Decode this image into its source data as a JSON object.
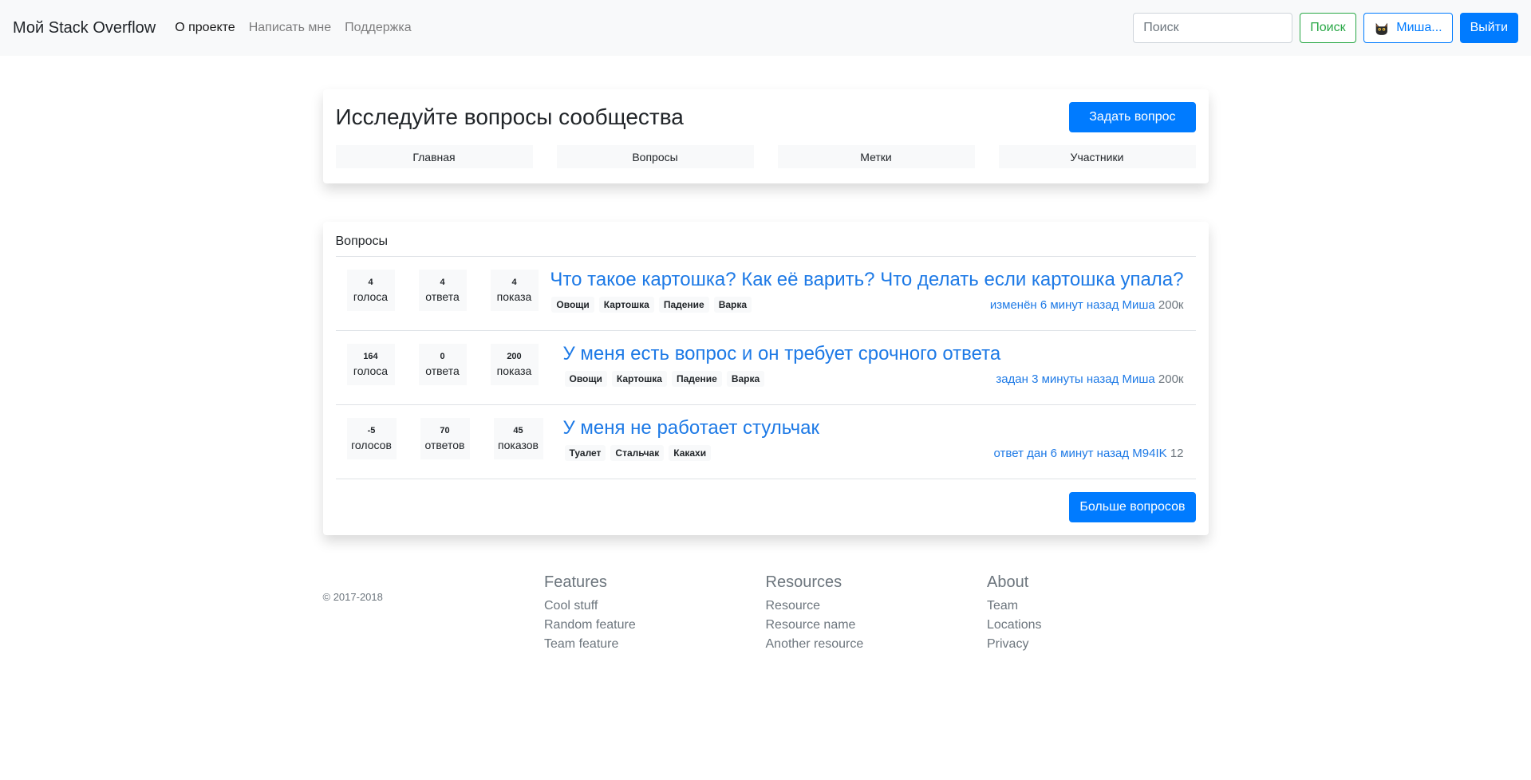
{
  "navbar": {
    "brand": "Мой Stack Overflow",
    "links": [
      "О проекте",
      "Написать мне",
      "Поддержка"
    ],
    "search_placeholder": "Поиск",
    "search_button": "Поиск",
    "user_button": "Миша...",
    "logout_button": "Выйти"
  },
  "explore": {
    "title": "Исследуйте вопросы сообщества",
    "ask_button": "Задать вопрос",
    "tabs": [
      "Главная",
      "Вопросы",
      "Метки",
      "Участники"
    ]
  },
  "questions": {
    "label": "Вопросы",
    "items": [
      {
        "votes": "4",
        "votes_label": "голоса",
        "answers": "4",
        "answers_label": "ответа",
        "views": "4",
        "views_label": "показа",
        "title": "Что такое картошка? Как её варить? Что делать если картошка упала?",
        "tags": [
          "Овощи",
          "Картошка",
          "Падение",
          "Варка"
        ],
        "meta": "изменён 6 минут назад Миша",
        "rep": "200к"
      },
      {
        "votes": "164",
        "votes_label": "голоса",
        "answers": "0",
        "answers_label": "ответа",
        "views": "200",
        "views_label": "показа",
        "title": "У меня есть вопрос и он требует срочного ответа",
        "tags": [
          "Овощи",
          "Картошка",
          "Падение",
          "Варка"
        ],
        "meta": "задан 3 минуты назад Миша",
        "rep": "200к"
      },
      {
        "votes": "-5",
        "votes_label": "голосов",
        "answers": "70",
        "answers_label": "ответов",
        "views": "45",
        "views_label": "показов",
        "title": "У меня не работает стульчак",
        "tags": [
          "Туалет",
          "Стальчак",
          "Какахи"
        ],
        "meta": "ответ дан 6 минут назад M94IK",
        "rep": "12"
      }
    ],
    "more_button": "Больше вопросов"
  },
  "footer": {
    "copyright": "© 2017-2018",
    "columns": [
      {
        "title": "Features",
        "links": [
          "Cool stuff",
          "Random feature",
          "Team feature"
        ]
      },
      {
        "title": "Resources",
        "links": [
          "Resource",
          "Resource name",
          "Another resource"
        ]
      },
      {
        "title": "About",
        "links": [
          "Team",
          "Locations",
          "Privacy"
        ]
      }
    ]
  },
  "colors": {
    "primary": "#007bff",
    "success": "#28a745",
    "link": "#1e7ae6",
    "navbar_bg": "#f8f9fa",
    "muted": "#6c757d"
  }
}
